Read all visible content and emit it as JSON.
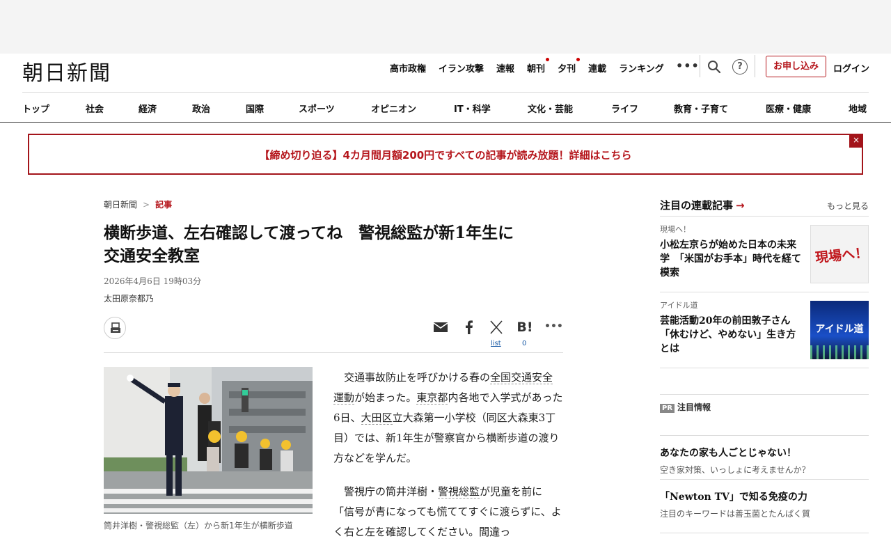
{
  "header": {
    "logo": "朝日新聞",
    "top_links": [
      {
        "label": "高市政権",
        "dot": false
      },
      {
        "label": "イラン攻撃",
        "dot": false
      },
      {
        "label": "速報",
        "dot": false
      },
      {
        "label": "朝刊",
        "dot": true
      },
      {
        "label": "夕刊",
        "dot": true
      },
      {
        "label": "連載",
        "dot": false
      },
      {
        "label": "ランキング",
        "dot": false
      }
    ],
    "more": "•••",
    "help": "?",
    "subscribe": "お申し込み",
    "login": "ログイン"
  },
  "categories": [
    "トップ",
    "社会",
    "経済",
    "政治",
    "国際",
    "スポーツ",
    "オピニオン",
    "IT・科学",
    "文化・芸能",
    "ライフ",
    "教育・子育て",
    "医療・健康",
    "地域"
  ],
  "promo": {
    "text": "【締め切り迫る】4カ月間月額200円ですべての記事が読み放題！詳細はこちら",
    "close": "×"
  },
  "article": {
    "breadcrumb_home": "朝日新聞",
    "breadcrumb_sep": ">",
    "breadcrumb_current": "記事",
    "headline_line1": "横断歩道、左右確認して渡ってね　警視総監が新1年生に",
    "headline_line2": "交通安全教室",
    "date": "2026年4月6日 19時03分",
    "author": "太田原奈都乃",
    "share_x_label": "list",
    "share_hatena_count": "0",
    "caption": "筒井洋樹・警視総監（左）から新1年生が横断歩道",
    "p1": {
      "t1": "交通事故防止を呼びかける春の",
      "k1": "全国交通安全運動",
      "t2": "が始まった。",
      "k2": "東京都",
      "t3": "内各地で入学式があった6日、",
      "k3": "大田区",
      "t4": "立大森第一小学校（同区大森東3丁目）では、新1年生が警察官から横断歩道の渡り方などを学んだ。"
    },
    "p2": {
      "t1": "警視庁の筒井洋樹・",
      "k1": "警視総監",
      "t2": "が児童を前に「信号が青になっても慌ててすぐに渡らずに、よく右と左を確認してください。間違っ"
    }
  },
  "sidebar": {
    "title": "注目の連載記事",
    "arrow": "→",
    "more": "もっと見る",
    "items": [
      {
        "kicker": "現場へ！",
        "title": "小松左京らが始めた日本の未来学　「米国がお手本」時代を経て模索",
        "thumb_text": "現場へ！"
      },
      {
        "kicker": "アイドル道",
        "title": "芸能活動20年の前田敦子さん「休むけど、やめない」生き方とは",
        "thumb_text": "アイドル道"
      }
    ],
    "pr_badge": "PR",
    "pr_title": "注目情報",
    "pr_items": [
      {
        "title": "あなたの家も人ごとじゃない！",
        "sub": "空き家対策、いっしょに考えませんか？"
      },
      {
        "title": "「Newton TV」で知る免疫の力",
        "sub": "注目のキーワードは善玉菌とたんぱく質"
      }
    ]
  },
  "colors": {
    "accent": "#b5161c",
    "link": "#1a5ba6"
  }
}
